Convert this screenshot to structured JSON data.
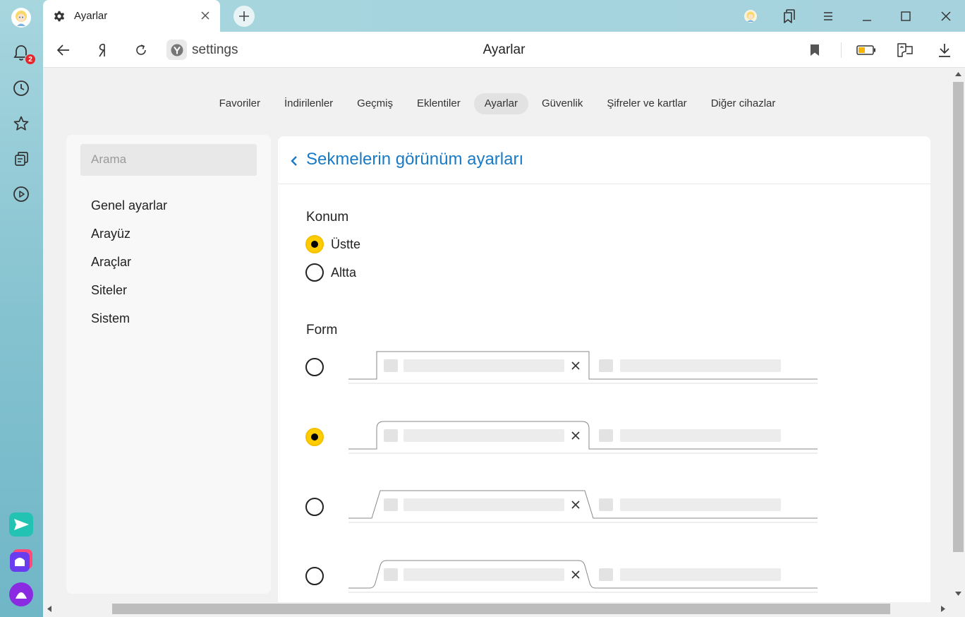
{
  "sidebar": {
    "notifications_badge": "2",
    "items": [
      "profile-avatar",
      "bell-icon",
      "clock-icon",
      "star-icon",
      "collections-icon",
      "play-icon"
    ],
    "bottom_apps": [
      "messenger-icon",
      "smart-home-icon",
      "alice-icon"
    ]
  },
  "tab": {
    "title": "Ayarlar",
    "icon": "gear-icon"
  },
  "addressbar": {
    "url": "settings",
    "page_title": "Ayarlar"
  },
  "topnav": {
    "items": [
      "Favoriler",
      "İndirilenler",
      "Geçmiş",
      "Eklentiler",
      "Ayarlar",
      "Güvenlik",
      "Şifreler ve kartlar",
      "Diğer cihazlar"
    ],
    "active": "Ayarlar"
  },
  "left_panel": {
    "search_placeholder": "Arama",
    "menu": [
      "Genel ayarlar",
      "Arayüz",
      "Araçlar",
      "Siteler",
      "Sistem"
    ]
  },
  "main": {
    "heading": "Sekmelerin görünüm ayarları",
    "position": {
      "label": "Konum",
      "options": [
        {
          "label": "Üstte",
          "checked": true
        },
        {
          "label": "Altta",
          "checked": false
        }
      ]
    },
    "form": {
      "label": "Form",
      "options": [
        {
          "style": "rectangular",
          "checked": false
        },
        {
          "style": "rounded",
          "checked": true
        },
        {
          "style": "trapezoid",
          "checked": false
        },
        {
          "style": "curved-trapezoid",
          "checked": false
        }
      ]
    }
  },
  "colors": {
    "accent_yellow": "#ffcc00",
    "heading_blue": "#1a7ac5",
    "badge_red": "#e5262a"
  }
}
